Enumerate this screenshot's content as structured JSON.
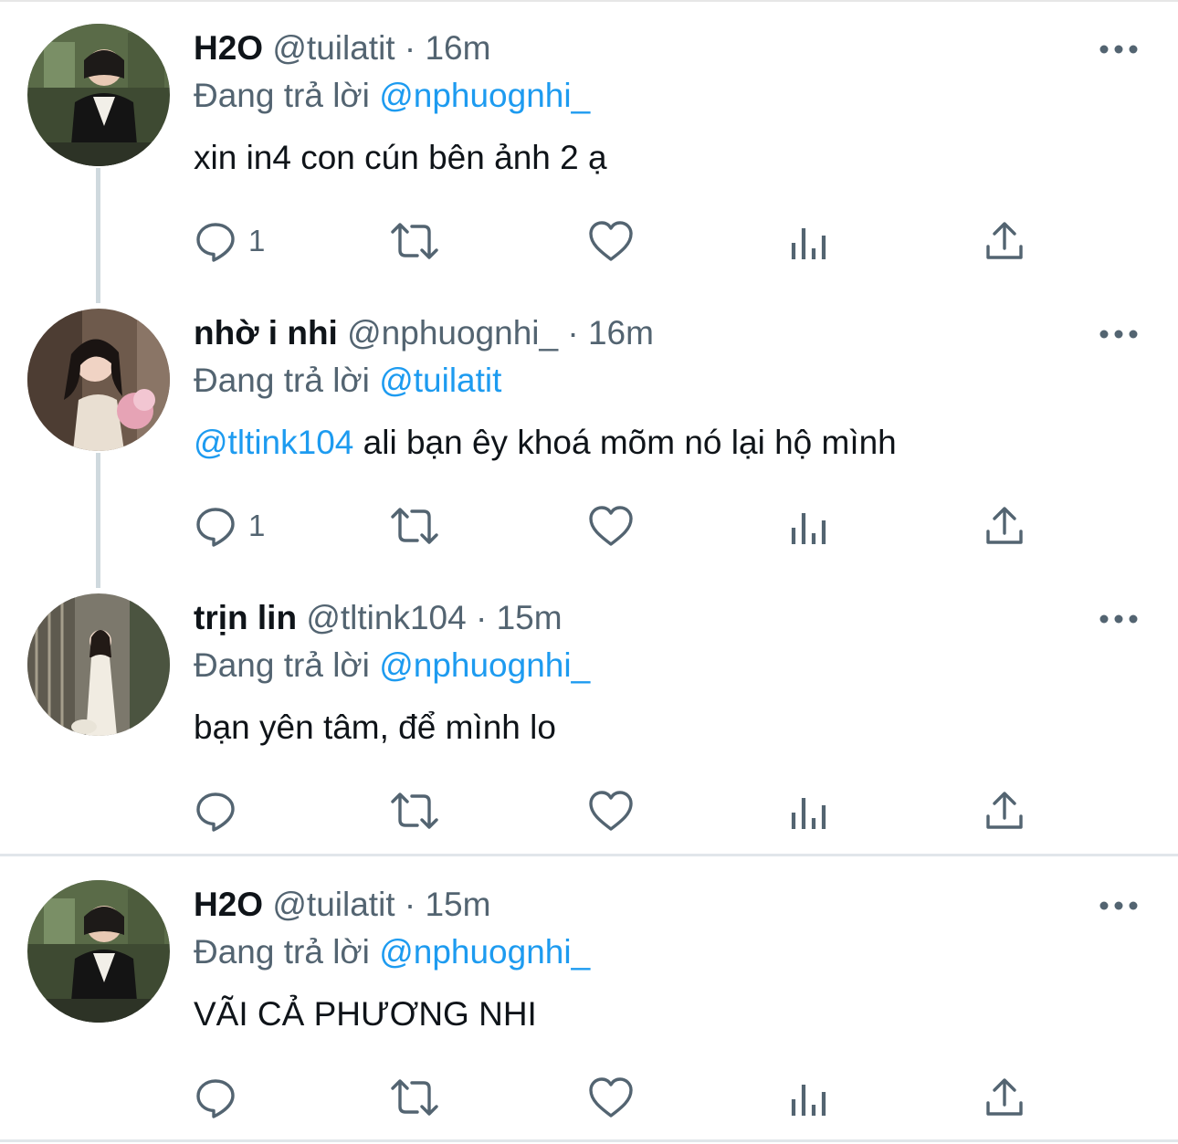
{
  "tweets": [
    {
      "name": "H2O",
      "handle": "@tuilatit",
      "sep": "·",
      "time": "16m",
      "reply_prefix": "Đang trả lời",
      "reply_to": "@nphuognhi_",
      "text_mention": "",
      "text": "xin in4 con cún bên ảnh 2 ạ",
      "reply_count": "1"
    },
    {
      "name": "nhờ i nhi",
      "handle": "@nphuognhi_",
      "sep": "·",
      "time": "16m",
      "reply_prefix": "Đang trả lời",
      "reply_to": "@tuilatit",
      "text_mention": "@tltink104",
      "text": " ali bạn êy khoá mõm nó lại hộ mình",
      "reply_count": "1"
    },
    {
      "name": "trịn lin",
      "handle": "@tltink104",
      "sep": "·",
      "time": "15m",
      "reply_prefix": "Đang trả lời",
      "reply_to": "@nphuognhi_",
      "text_mention": "",
      "text": "bạn yên tâm, để mình lo",
      "reply_count": ""
    },
    {
      "name": "H2O",
      "handle": "@tuilatit",
      "sep": "·",
      "time": "15m",
      "reply_prefix": "Đang trả lời",
      "reply_to": "@nphuognhi_",
      "text_mention": "",
      "text": "VÃI CẢ PHƯƠNG NHI",
      "reply_count": ""
    }
  ],
  "colors": {
    "text": "#0f1419",
    "secondary": "#536471",
    "accent": "#1d9bf0",
    "thread_line": "#cfd9de"
  },
  "icons": [
    "reply-icon",
    "retweet-icon",
    "like-icon",
    "views-icon",
    "share-icon",
    "more-icon"
  ]
}
